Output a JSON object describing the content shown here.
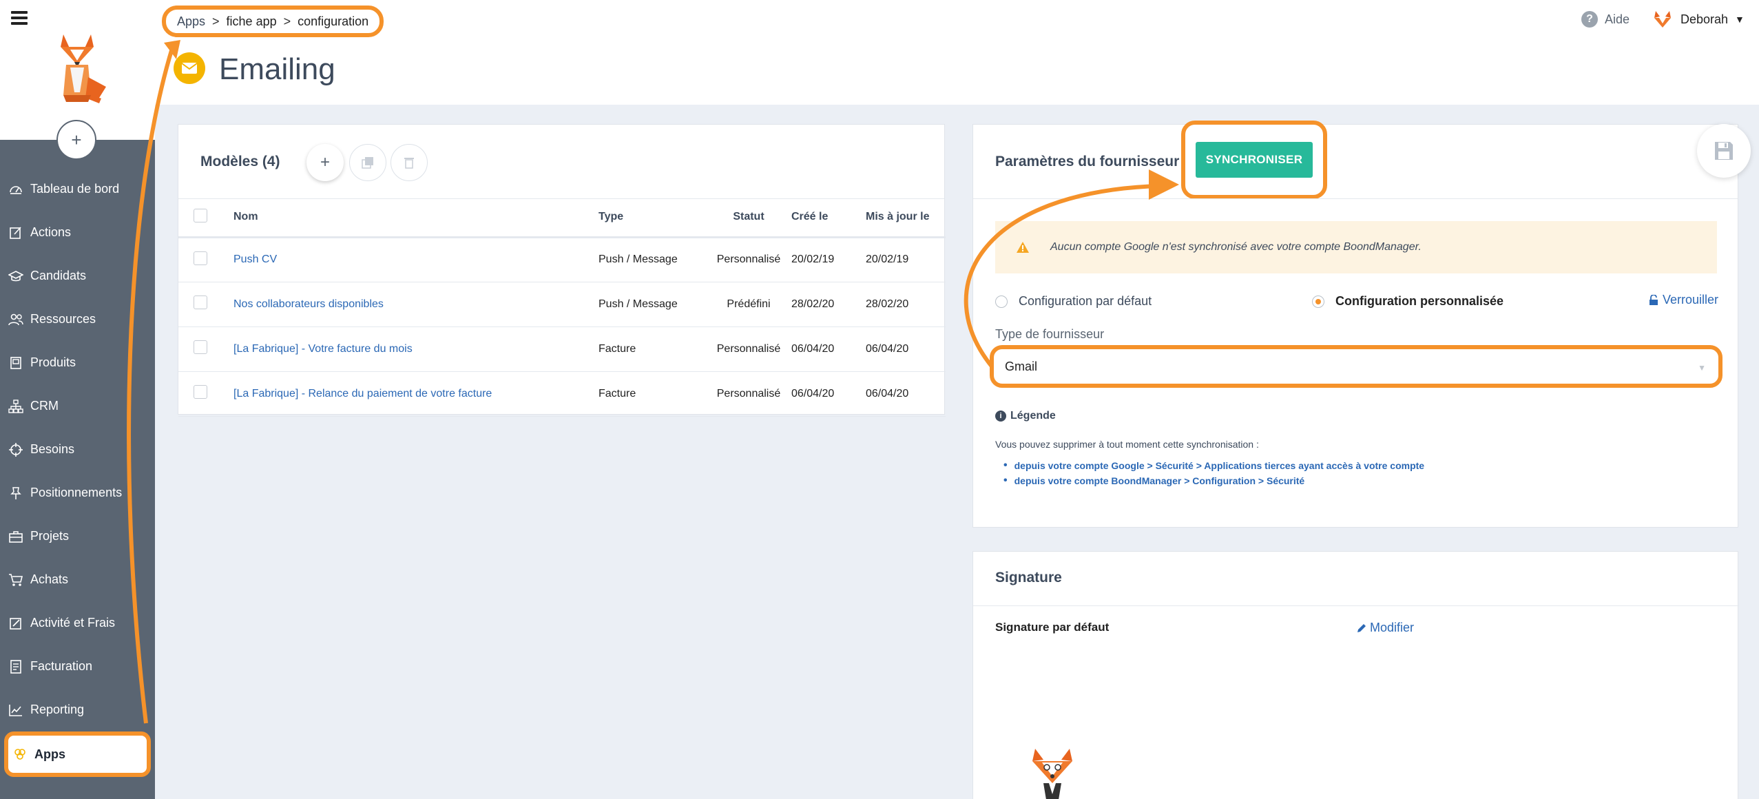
{
  "breadcrumb": {
    "items": [
      "Apps",
      "fiche app",
      "configuration"
    ]
  },
  "page": {
    "title": "Emailing"
  },
  "header": {
    "help_label": "Aide",
    "user_name": "Deborah"
  },
  "sidebar": {
    "items": [
      {
        "label": "Tableau de bord",
        "icon": "dashboard-icon"
      },
      {
        "label": "Actions",
        "icon": "edit-icon"
      },
      {
        "label": "Candidats",
        "icon": "graduation-cap-icon"
      },
      {
        "label": "Ressources",
        "icon": "users-icon"
      },
      {
        "label": "Produits",
        "icon": "box-icon"
      },
      {
        "label": "CRM",
        "icon": "sitemap-icon"
      },
      {
        "label": "Besoins",
        "icon": "target-icon"
      },
      {
        "label": "Positionnements",
        "icon": "pin-icon"
      },
      {
        "label": "Projets",
        "icon": "briefcase-icon"
      },
      {
        "label": "Achats",
        "icon": "cart-icon"
      },
      {
        "label": "Activité et Frais",
        "icon": "pencil-square-icon"
      },
      {
        "label": "Facturation",
        "icon": "invoice-icon"
      },
      {
        "label": "Reporting",
        "icon": "chart-icon"
      },
      {
        "label": "Apps",
        "icon": "apps-icon",
        "active": true
      }
    ]
  },
  "models": {
    "title": "Modèles (4)",
    "columns": [
      "Nom",
      "Type",
      "Statut",
      "Créé le",
      "Mis à jour le"
    ],
    "rows": [
      {
        "name": "Push CV",
        "type": "Push / Message",
        "status": "Personnalisé",
        "created": "20/02/19",
        "updated": "20/02/19"
      },
      {
        "name": "Nos collaborateurs disponibles",
        "type": "Push / Message",
        "status": "Prédéfini",
        "created": "28/02/20",
        "updated": "28/02/20"
      },
      {
        "name": "[La Fabrique] - Votre facture du mois",
        "type": "Facture",
        "status": "Personnalisé",
        "created": "06/04/20",
        "updated": "06/04/20"
      },
      {
        "name": "[La Fabrique] - Relance du paiement de votre facture",
        "type": "Facture",
        "status": "Personnalisé",
        "created": "06/04/20",
        "updated": "06/04/20"
      }
    ]
  },
  "provider": {
    "title": "Paramètres du fournisseur",
    "sync_label": "SYNCHRONISER",
    "warning": "Aucun compte Google n'est synchronisé avec votre compte BoondManager.",
    "radio_default": "Configuration par défaut",
    "radio_custom": "Configuration personnalisée",
    "lock_label": "Verrouiller",
    "type_label": "Type de fournisseur",
    "type_value": "Gmail",
    "legend_title": "Légende",
    "legend_text": "Vous pouvez supprimer à tout moment cette synchronisation :",
    "legend_items": [
      "depuis votre compte Google > Sécurité > Applications tierces ayant accès à votre compte",
      "depuis votre compte BoondManager > Configuration > Sécurité"
    ]
  },
  "signature": {
    "title": "Signature",
    "default_label": "Signature par défaut",
    "modify_label": "Modifier"
  },
  "colors": {
    "accent": "#f5922a",
    "sync": "#27b99a",
    "sidebar": "#5a6572",
    "link": "#2b68b5"
  }
}
